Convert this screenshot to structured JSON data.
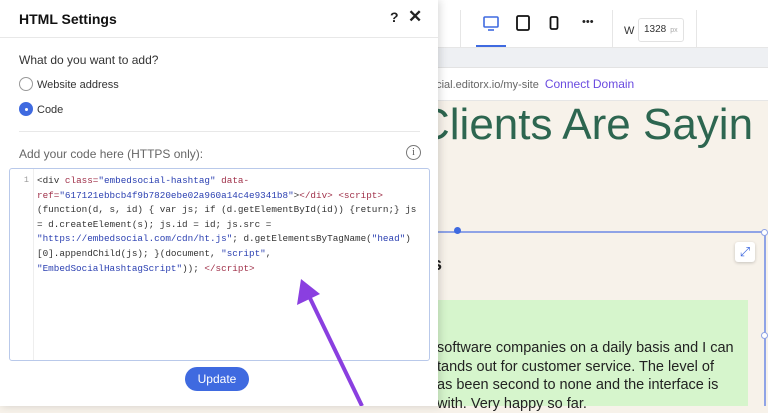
{
  "panel": {
    "title": "HTML Settings",
    "help_label": "?",
    "close_label": "✕",
    "question": "What do you want to add?",
    "options": [
      {
        "label": "Website address",
        "selected": false
      },
      {
        "label": "Code",
        "selected": true
      }
    ],
    "code_label": "Add your code here (HTTPS only):",
    "info_label": "i",
    "line_number": "1",
    "code_lines": [
      "<div class=\"embedsocial-hashtag\" data-",
      "ref=\"617121ebbcb4f9b7820ebe02a960a14c4e9341b8\"></div> <script>",
      "(function(d, s, id) { var js; if (d.getElementById(id)) {return;} js",
      "= d.createElement(s); js.id = id; js.src =",
      "\"https://embedsocial.com/cdn/ht.js\"; d.getElementsByTagName(\"head\")",
      "[0].appendChild(js); }(document, \"script\",",
      "\"EmbedSocialHashtagScript\")); </script>"
    ],
    "update_label": "Update"
  },
  "toolbar": {
    "devices": [
      "desktop-icon",
      "tablet-icon",
      "mobile-icon"
    ],
    "active_device": "desktop",
    "more_label": "•••",
    "width_label": "W",
    "width_value": "1328",
    "width_unit": "px"
  },
  "urlbar": {
    "url": "ocial.editorx.io/my-site",
    "connect_label": "Connect Domain"
  },
  "canvas": {
    "heading": "Clients Are Sayin",
    "subheading_fragment": "s",
    "quote_lines": [
      "software companies on a daily basis and I can",
      "tands out for customer service. The level of",
      "as been second to none and the interface is",
      "with. Very happy so far."
    ]
  },
  "colors": {
    "accent": "#3f6ae0",
    "heading": "#2d6650",
    "quote_bg": "#d6f5cc",
    "page_bg": "#f7f2ea",
    "annotation_arrow": "#8a3fe0"
  }
}
